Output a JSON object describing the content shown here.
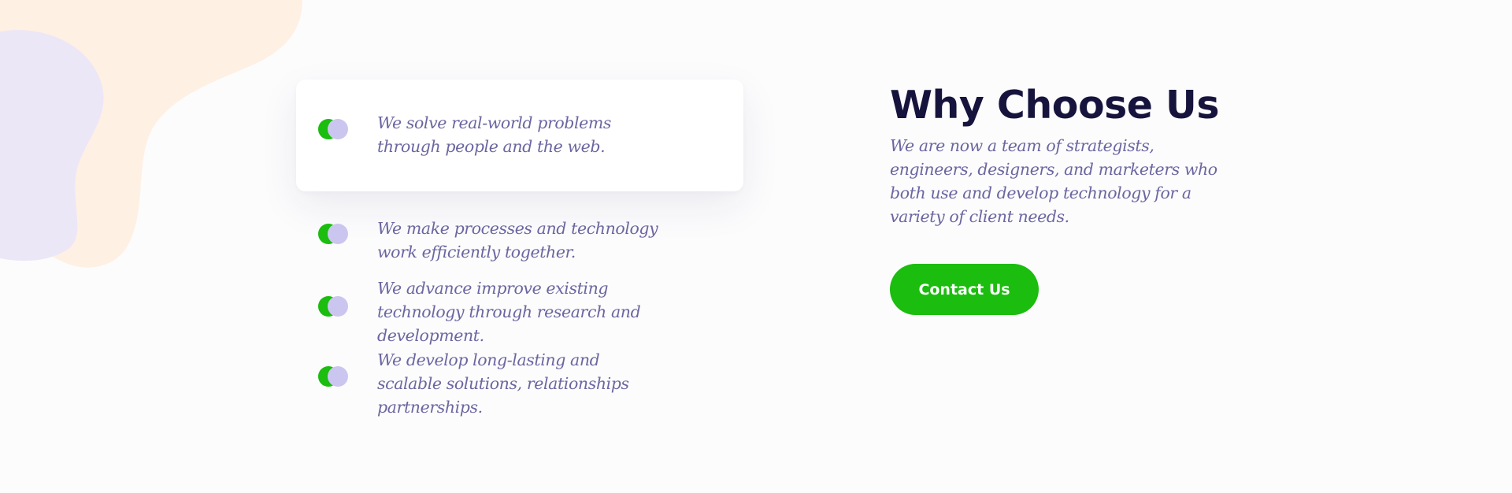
{
  "colors": {
    "accent_green": "#1bbd0e",
    "lilac": "#cbc6ef",
    "heading": "#16143d",
    "body_text": "#6b66a0",
    "blob_peach": "#fff0e4",
    "blob_lavender": "#ece7f7",
    "background": "#fcfcfd"
  },
  "features": [
    {
      "icon": "toggle-dots-icon",
      "lines": [
        "We solve real-world problems",
        "through people and the web."
      ],
      "highlighted": true
    },
    {
      "icon": "toggle-dots-icon",
      "lines": [
        "We make processes and technology",
        "work efficiently together."
      ],
      "highlighted": false
    },
    {
      "icon": "toggle-dots-icon",
      "lines": [
        "We advance improve existing",
        "technology through research and",
        "development."
      ],
      "highlighted": false
    },
    {
      "icon": "toggle-dots-icon",
      "lines": [
        "We develop long-lasting and",
        "scalable solutions, relationships",
        "partnerships."
      ],
      "highlighted": false
    }
  ],
  "why": {
    "title": "Why Choose Us",
    "description_lines": [
      "We are now a team of strategists,",
      "engineers, designers, and marketers who",
      "both use and develop technology for a",
      "variety of client needs."
    ],
    "button_label": "Contact Us"
  }
}
